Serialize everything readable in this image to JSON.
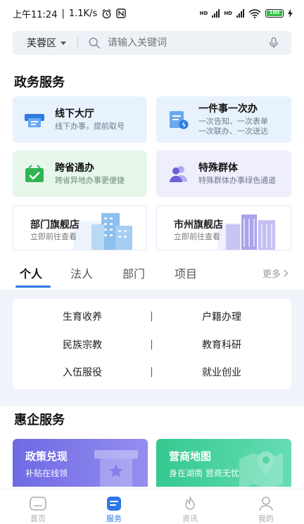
{
  "status": {
    "time": "上午11:24",
    "speed": "1.1K/s",
    "battery": "100",
    "net1": "HD",
    "net2": "HD"
  },
  "search": {
    "region": "芙蓉区",
    "placeholder": "请输入关键词"
  },
  "gov": {
    "title": "政务服务",
    "cards": [
      {
        "title": "线下大厅",
        "sub": "线下办事，提前取号"
      },
      {
        "title": "一件事一次办",
        "sub1": "一次告知、一次表单",
        "sub2": "一次联办、一次送达"
      },
      {
        "title": "跨省通办",
        "sub": "跨省异地办事更便捷"
      },
      {
        "title": "特殊群体",
        "sub": "特殊群体办事绿色通道"
      }
    ],
    "stores": [
      {
        "title": "部门旗舰店",
        "sub": "立即前往查看"
      },
      {
        "title": "市州旗舰店",
        "sub": "立即前往查看"
      }
    ]
  },
  "tabs": {
    "items": [
      "个人",
      "法人",
      "部门",
      "项目"
    ],
    "more": "更多"
  },
  "categories": [
    "生育收养",
    "户籍办理",
    "民族宗教",
    "教育科研",
    "入伍服役",
    "就业创业"
  ],
  "benefit": {
    "title": "惠企服务",
    "cards": [
      {
        "title": "政策兑现",
        "sub": "补贴在线领"
      },
      {
        "title": "营商地图",
        "sub": "身在湖南 营商无忧"
      }
    ]
  },
  "nav": {
    "items": [
      "首页",
      "服务",
      "资讯",
      "我的"
    ]
  },
  "colors": {
    "accent": "#2d78e6",
    "card_blue": "#e8f2fc",
    "card_green": "#e6f7ea",
    "card_purple": "#eeeefc",
    "benefit_purple": "#7a74e8",
    "benefit_green": "#3fcf9a"
  }
}
